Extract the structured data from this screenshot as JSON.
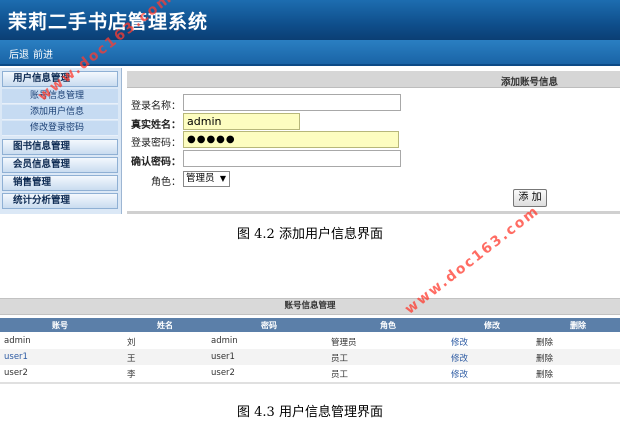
{
  "app": {
    "title": "茉莉二手书店管理系统"
  },
  "nav": {
    "back": "后退",
    "forward": "前进"
  },
  "sidebar": {
    "groups": [
      {
        "label": "用户信息管理",
        "items": [
          "账号信息管理",
          "添加用户信息",
          "修改登录密码"
        ]
      },
      {
        "label": "图书信息管理"
      },
      {
        "label": "会员信息管理"
      },
      {
        "label": "销售管理"
      },
      {
        "label": "统计分析管理"
      }
    ]
  },
  "add_form": {
    "title": "添加账号信息",
    "login_name_label": "登录名称：",
    "login_name_value": "",
    "real_name_label": "真实姓名：",
    "real_name_value": "admin",
    "password_label": "登录密码：",
    "password_value": "●●●●●",
    "confirm_label": "确认密码：",
    "confirm_value": "",
    "role_label": "角色：",
    "role_value": "管理员",
    "add_button": "添 加"
  },
  "captions": {
    "fig42": "图 4.2  添加用户信息界面",
    "fig43": "图 4.3  用户信息管理界面"
  },
  "account_table": {
    "title": "账号信息管理",
    "columns": [
      "账号",
      "姓名",
      "密码",
      "角色",
      "修改",
      "删除"
    ],
    "rows": [
      {
        "account": "admin",
        "name": "刘",
        "password": "admin",
        "role": "管理员",
        "edit": "修改",
        "delete": "删除"
      },
      {
        "account": "user1",
        "name": "王",
        "password": "user1",
        "role": "员工",
        "edit": "修改",
        "delete": "删除"
      },
      {
        "account": "user2",
        "name": "李",
        "password": "user2",
        "role": "员工",
        "edit": "修改",
        "delete": "删除"
      }
    ]
  },
  "watermark": "www.doc163.com",
  "colors": {
    "header": "#0f4f8c",
    "table_header": "#5b7fa9",
    "watermark": "#ff3b2f",
    "input_highlight": "#fdfdc0"
  }
}
